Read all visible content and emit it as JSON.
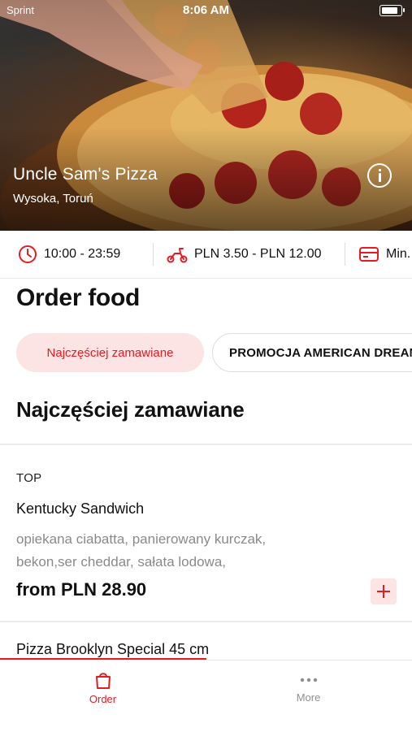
{
  "status_bar": {
    "carrier": "Sprint",
    "time": "8:06 AM"
  },
  "restaurant": {
    "name": "Uncle Sam's Pizza",
    "location": "Wysoka, Toruń"
  },
  "info_strip": {
    "hours": "10:00 - 23:59",
    "delivery_fee": "PLN 3.50 - PLN 12.00",
    "minimum": "Min."
  },
  "main": {
    "title": "Order food"
  },
  "categories": [
    {
      "label": "Najczęściej zamawiane",
      "active": true
    },
    {
      "label": "PROMOCJA AMERICAN DREAM",
      "active": false
    }
  ],
  "section": {
    "heading": "Najczęściej zamawiane"
  },
  "items": [
    {
      "tag": "TOP",
      "name": "Kentucky Sandwich",
      "description_line1": "opiekana ciabatta, panierowany kurczak,",
      "description_line2": "bekon,ser cheddar, sałata lodowa,",
      "price": "from PLN 28.90"
    },
    {
      "name": "Pizza Brooklyn Special 45 cm"
    }
  ],
  "tab_bar": {
    "tabs": [
      {
        "label": "Order",
        "icon": "shopping-bag-icon",
        "active": true
      },
      {
        "label": "More",
        "icon": "more-dots-icon",
        "active": false
      }
    ]
  },
  "colors": {
    "accent": "#e31c23",
    "accent_light": "#fde4e4",
    "muted_text": "#8a8a8a"
  }
}
